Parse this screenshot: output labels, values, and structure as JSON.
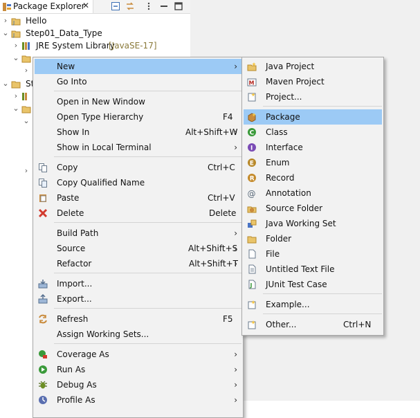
{
  "view": {
    "tab_label": "Package Explorer",
    "close_glyph": "✕"
  },
  "tree": [
    {
      "label": "Hello",
      "icon": "project-icon",
      "twisty": "›"
    },
    {
      "label": "Step01_Data_Type",
      "icon": "project-icon",
      "twisty": "⌄"
    },
    {
      "label": "JRE System Library",
      "suffix": "[JavaSE-17]",
      "icon": "library-icon",
      "twisty": "›"
    },
    {
      "label": "",
      "icon": "package-folder-icon",
      "twisty": "⌄"
    },
    {
      "label": "St",
      "icon": "project-icon",
      "twisty": "⌄"
    }
  ],
  "context_menu": [
    {
      "label": "New",
      "submenu": true,
      "highlighted": true
    },
    {
      "label": "Go Into"
    },
    {
      "label": "Open in New Window"
    },
    {
      "label": "Open Type Hierarchy",
      "shortcut": "F4"
    },
    {
      "label": "Show In",
      "shortcut": "Alt+Shift+W",
      "submenu": true
    },
    {
      "label": "Show in Local Terminal",
      "submenu": true
    },
    {
      "label": "Copy",
      "shortcut": "Ctrl+C",
      "icon": "copy-icon"
    },
    {
      "label": "Copy Qualified Name",
      "icon": "copy-qualified-icon"
    },
    {
      "label": "Paste",
      "shortcut": "Ctrl+V",
      "icon": "paste-icon"
    },
    {
      "label": "Delete",
      "shortcut": "Delete",
      "icon": "delete-icon"
    },
    {
      "label": "Build Path",
      "submenu": true
    },
    {
      "label": "Source",
      "shortcut": "Alt+Shift+S",
      "submenu": true
    },
    {
      "label": "Refactor",
      "shortcut": "Alt+Shift+T",
      "submenu": true
    },
    {
      "label": "Import...",
      "icon": "import-icon"
    },
    {
      "label": "Export...",
      "icon": "export-icon"
    },
    {
      "label": "Refresh",
      "shortcut": "F5",
      "icon": "refresh-icon"
    },
    {
      "label": "Assign Working Sets..."
    },
    {
      "label": "Coverage As",
      "submenu": true,
      "icon": "coverage-icon"
    },
    {
      "label": "Run As",
      "submenu": true,
      "icon": "run-icon"
    },
    {
      "label": "Debug As",
      "submenu": true,
      "icon": "debug-icon"
    },
    {
      "label": "Profile As",
      "submenu": true,
      "icon": "profile-icon"
    }
  ],
  "submenu": [
    {
      "label": "Java Project",
      "icon": "java-project-icon"
    },
    {
      "label": "Maven Project",
      "icon": "maven-project-icon"
    },
    {
      "label": "Project...",
      "icon": "project-wizard-icon"
    },
    {
      "label": "Package",
      "icon": "package-icon",
      "highlighted": true
    },
    {
      "label": "Class",
      "icon": "class-icon"
    },
    {
      "label": "Interface",
      "icon": "interface-icon"
    },
    {
      "label": "Enum",
      "icon": "enum-icon"
    },
    {
      "label": "Record",
      "icon": "record-icon"
    },
    {
      "label": "Annotation",
      "icon": "annotation-icon"
    },
    {
      "label": "Source Folder",
      "icon": "source-folder-icon"
    },
    {
      "label": "Java Working Set",
      "icon": "working-set-icon"
    },
    {
      "label": "Folder",
      "icon": "folder-icon"
    },
    {
      "label": "File",
      "icon": "file-icon"
    },
    {
      "label": "Untitled Text File",
      "icon": "text-file-icon"
    },
    {
      "label": "JUnit Test Case",
      "icon": "junit-icon"
    },
    {
      "label": "Example...",
      "icon": "example-icon"
    },
    {
      "label": "Other...",
      "shortcut": "Ctrl+N",
      "icon": "other-icon"
    }
  ],
  "glyphs": {
    "submenu_arrow": "›"
  },
  "colors": {
    "highlight": "#9ccaf5",
    "menu_bg": "#f2f2f2",
    "library_suffix": "#8a7a3a"
  }
}
